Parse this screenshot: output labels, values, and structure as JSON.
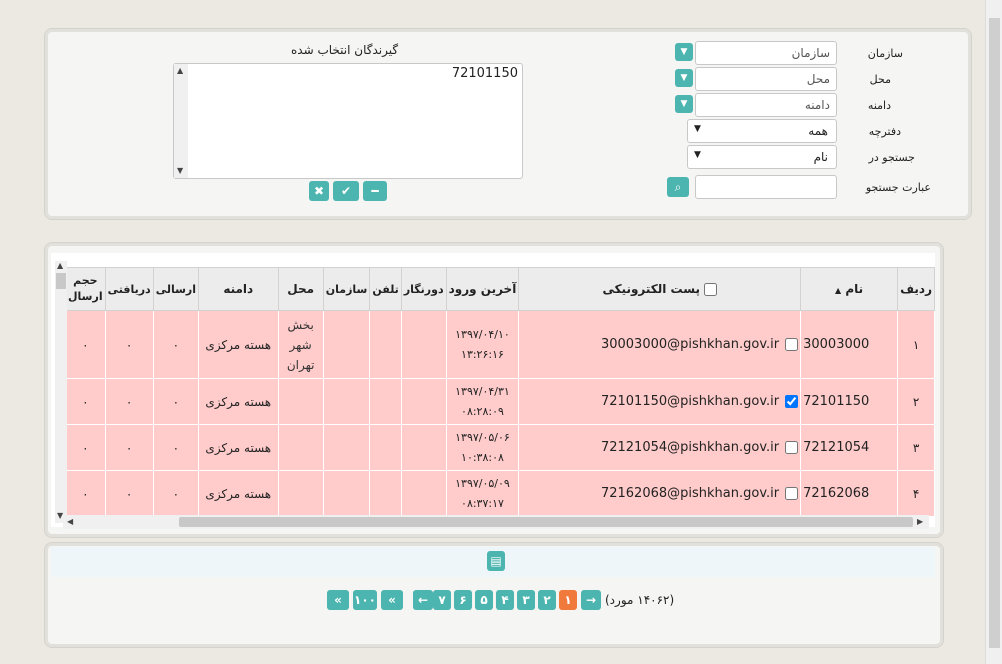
{
  "filters": {
    "organization": {
      "label": "سازمان",
      "placeholder": "سازمان"
    },
    "location": {
      "label": "محل",
      "placeholder": "محل"
    },
    "domain": {
      "label": "دامنه",
      "placeholder": "دامنه"
    },
    "folder": {
      "label": "دفترچه",
      "value": "همه"
    },
    "search_in": {
      "label": "جستجو در",
      "value": "نام"
    },
    "search_phrase": {
      "label": "عبارت جستجو",
      "value": ""
    }
  },
  "recipients": {
    "title": "گیرندگان انتخاب شده",
    "value": "72101150"
  },
  "grid": {
    "headers": {
      "row": "ردیف",
      "name": "نام",
      "email": "پست الکترونیکی",
      "last_login": "آخرین ورود",
      "fax": "دورنگار",
      "phone": "تلفن",
      "org": "سازمان",
      "location": "محل",
      "domain": "دامنه",
      "sent": "ارسالی",
      "received": "دریافتی",
      "sent_size_1": "حجم",
      "sent_size_2": "ارسال"
    },
    "rows": [
      {
        "row": "۱",
        "name": "30003000",
        "email": "30003000@pishkhan.gov.ir",
        "checked": false,
        "date": "۱۳۹۷/۰۴/۱۰",
        "time": "۱۳:۲۶:۱۶",
        "location_lines": [
          "بخش",
          "شهر",
          "تهران"
        ],
        "domain": "هسته مرکزی",
        "sent": "۰",
        "received": "۰",
        "size": "۰"
      },
      {
        "row": "۲",
        "name": "72101150",
        "email": "72101150@pishkhan.gov.ir",
        "checked": true,
        "date": "۱۳۹۷/۰۴/۳۱",
        "time": "۰۸:۲۸:۰۹",
        "location_lines": [],
        "domain": "هسته مرکزی",
        "sent": "۰",
        "received": "۰",
        "size": "۰"
      },
      {
        "row": "۳",
        "name": "72121054",
        "email": "72121054@pishkhan.gov.ir",
        "checked": false,
        "date": "۱۳۹۷/۰۵/۰۶",
        "time": "۱۰:۳۸:۰۸",
        "location_lines": [],
        "domain": "هسته مرکزی",
        "sent": "۰",
        "received": "۰",
        "size": "۰"
      },
      {
        "row": "۴",
        "name": "72162068",
        "email": "72162068@pishkhan.gov.ir",
        "checked": false,
        "date": "۱۳۹۷/۰۵/۰۹",
        "time": "۰۸:۳۷:۱۷",
        "location_lines": [],
        "domain": "هسته مرکزی",
        "sent": "۰",
        "received": "۰",
        "size": "۰"
      }
    ]
  },
  "pager": {
    "count_text": "(۱۴۰۶۲ مورد)",
    "pages": [
      "۱",
      "۲",
      "۳",
      "۴",
      "۵",
      "۶",
      "۷"
    ],
    "active_page": "۱",
    "jump_10": "۱۰",
    "jump_100": "۱۰۰"
  },
  "colors": {
    "accent": "#4cb5b0",
    "active_page": "#f07a3c",
    "row_bg": "#ffcccb"
  }
}
